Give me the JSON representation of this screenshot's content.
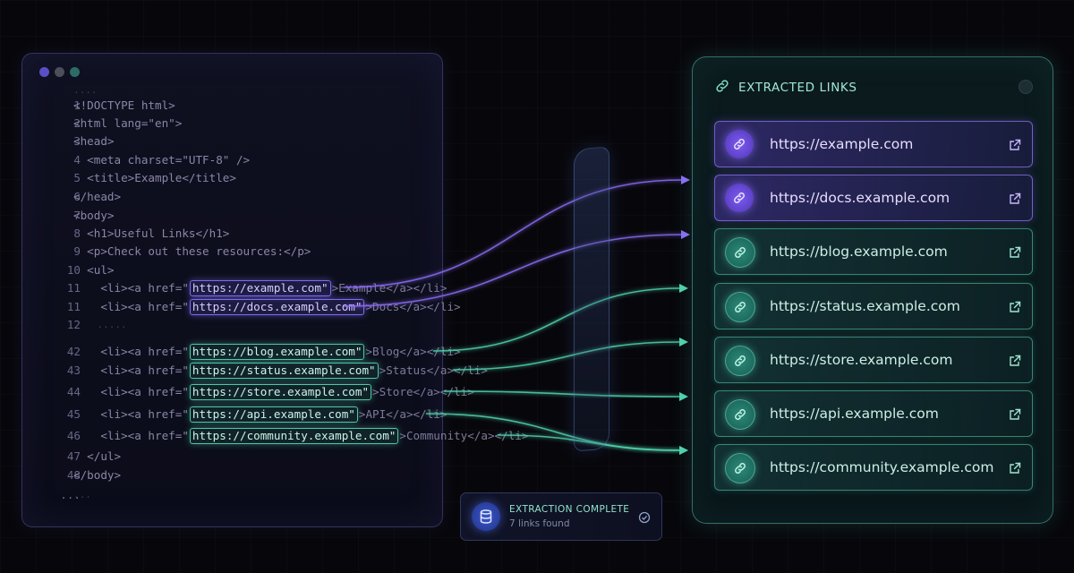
{
  "editor": {
    "window_dots": [
      "#5b4fc9",
      "#4a4f5a",
      "#2d6b66"
    ],
    "lines": [
      {
        "ln": "",
        "code": "...."
      },
      {
        "ln": "1",
        "code": "<!DOCTYPE html>"
      },
      {
        "ln": "2",
        "code": "<html lang=\"en\">"
      },
      {
        "ln": "3",
        "code": "<head>"
      },
      {
        "ln": "4",
        "code": "  <meta charset=\"UTF-8\" />"
      },
      {
        "ln": "5",
        "code": "  <title>Example</title>"
      },
      {
        "ln": "6",
        "code": "</head>"
      },
      {
        "ln": "7",
        "code": "<body>"
      },
      {
        "ln": "8",
        "code": "  <h1>Useful Links</h1>"
      },
      {
        "ln": "9",
        "code": "  <p>Check out these resources:</p>"
      },
      {
        "ln": "10",
        "code": "  <ul>"
      },
      {
        "ln": "11",
        "pre": "    <li><a href=\"",
        "url": "https://example.com\"",
        "post": ">Example</a></li>",
        "color": "purple"
      },
      {
        "ln": "11",
        "pre": "    <li><a href=\"",
        "url": "https://docs.example.com\"",
        "post": ">Docs</a></li>",
        "color": "purple"
      },
      {
        "ln": "12",
        "code": "    ....."
      },
      {
        "ln": "42",
        "pre": "    <li><a href=\"",
        "url": "https://blog.example.com\"",
        "post": ">Blog</a></li>",
        "color": "teal"
      },
      {
        "ln": "43",
        "pre": "    <li><a href=\"",
        "url": "https://status.example.com\"",
        "post": ">Status</a></li>",
        "color": "teal"
      },
      {
        "ln": "44",
        "pre": "    <li><a href=\"",
        "url": "https://store.example.com\"",
        "post": ">Store</a></li>",
        "color": "teal"
      },
      {
        "ln": "45",
        "pre": "    <li><a href=\"",
        "url": "https://api.example.com\"",
        "post": ">API</a></li>",
        "color": "teal"
      },
      {
        "ln": "46",
        "pre": "    <li><a href=\"",
        "url": "https://community.example.com\"",
        "post": ">Community</a></li>",
        "color": "teal"
      },
      {
        "ln": "47",
        "code": "  </ul>"
      },
      {
        "ln": "48",
        "code": "</body>"
      },
      {
        "ln": "...",
        "code": "..."
      }
    ]
  },
  "panel": {
    "title": "EXTRACTED LINKS",
    "title_icon": "link-icon",
    "links": [
      {
        "url": "https://example.com",
        "color": "purple"
      },
      {
        "url": "https://docs.example.com",
        "color": "purple"
      },
      {
        "url": "https://blog.example.com",
        "color": "teal"
      },
      {
        "url": "https://status.example.com",
        "color": "teal"
      },
      {
        "url": "https://store.example.com",
        "color": "teal"
      },
      {
        "url": "https://api.example.com",
        "color": "teal"
      },
      {
        "url": "https://community.example.com",
        "color": "teal"
      }
    ]
  },
  "status": {
    "title": "EXTRACTION COMPLETE",
    "subtitle": "7 links found",
    "icon": "database-icon"
  },
  "colors": {
    "purple": "#8b6cf5",
    "teal": "#4fd1ad",
    "background": "#07070b"
  }
}
